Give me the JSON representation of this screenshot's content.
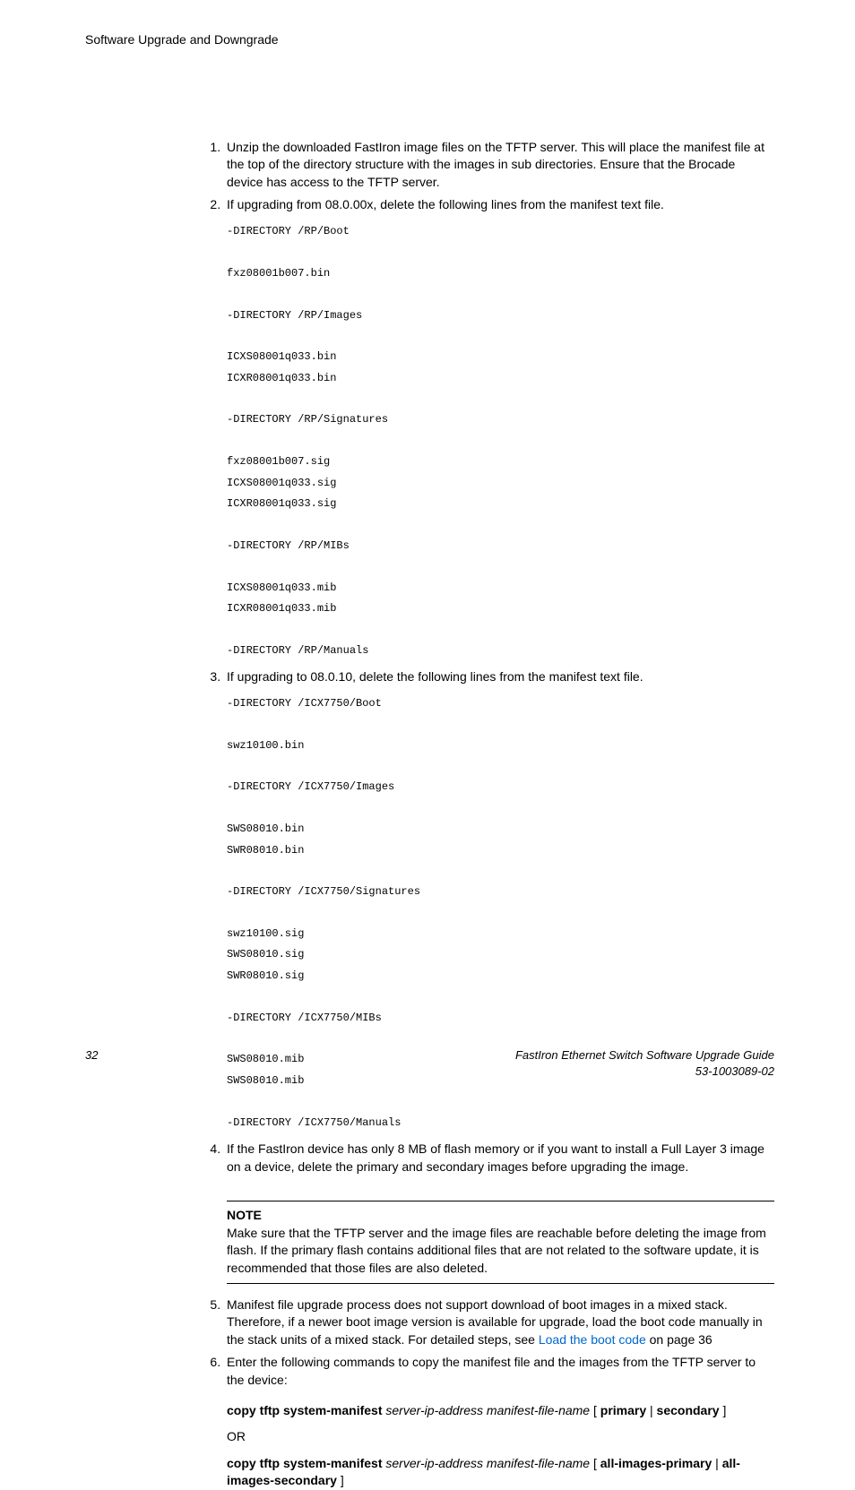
{
  "header_title": "Software Upgrade and Downgrade",
  "steps": {
    "s1": "Unzip the downloaded FastIron image files on the TFTP server. This will place the manifest file at the top of the directory structure with the images in sub directories. Ensure that the Brocade device has access to the TFTP server.",
    "s2": "If upgrading from 08.0.00x, delete the following lines from the manifest text file.",
    "s2_code": "-DIRECTORY /RP/Boot\n\nfxz08001b007.bin\n\n-DIRECTORY /RP/Images\n\nICXS08001q033.bin\nICXR08001q033.bin\n\n-DIRECTORY /RP/Signatures\n\nfxz08001b007.sig\nICXS08001q033.sig\nICXR08001q033.sig\n\n-DIRECTORY /RP/MIBs\n\nICXS08001q033.mib\nICXR08001q033.mib\n\n-DIRECTORY /RP/Manuals",
    "s3": "If upgrading to 08.0.10, delete the following lines from the manifest text file.",
    "s3_code": "-DIRECTORY /ICX7750/Boot\n\nswz10100.bin\n\n-DIRECTORY /ICX7750/Images\n\nSWS08010.bin\nSWR08010.bin\n\n-DIRECTORY /ICX7750/Signatures\n\nswz10100.sig\nSWS08010.sig\nSWR08010.sig\n\n-DIRECTORY /ICX7750/MIBs\n\nSWS08010.mib\nSWS08010.mib\n\n-DIRECTORY /ICX7750/Manuals",
    "s4": "If the FastIron device has only 8 MB of flash memory or if you want to install a Full Layer 3 image on a device, delete the primary and secondary images before upgrading the image.",
    "s5_a": "Manifest file upgrade process does not support download of boot images in a mixed stack. Therefore, if a newer boot image version is available for upgrade, load the boot code manually in the stack units of a mixed stack. For detailed steps, see ",
    "s5_link": "Load the boot code",
    "s5_b": " on page 36",
    "s6": "Enter the following commands to copy the manifest file and the images from the TFTP server to the device:"
  },
  "note": {
    "label": "NOTE",
    "body": "Make sure that the TFTP server and the image files are reachable before deleting the image from flash. If the primary flash contains additional files that are not related to the software update, it is recommended that those files are also deleted."
  },
  "commands": {
    "cmd1_bold1": "copy tftp system-manifest",
    "cmd1_italic": " server-ip-address manifest-file-name ",
    "cmd1_bold2": "primary",
    "cmd1_bold3": "secondary",
    "or": "OR",
    "cmd2_bold1": "copy tftp system-manifest",
    "cmd2_italic": " server-ip-address manifest-file-name ",
    "cmd2_bold2": "all-images-primary",
    "cmd2_bold3": "all-images-secondary",
    "lbracket": "[ ",
    "pipe": " | ",
    "rbracket": " ]"
  },
  "footer": {
    "page": "32",
    "title": "FastIron Ethernet Switch Software Upgrade Guide",
    "docnum": "53-1003089-02"
  }
}
